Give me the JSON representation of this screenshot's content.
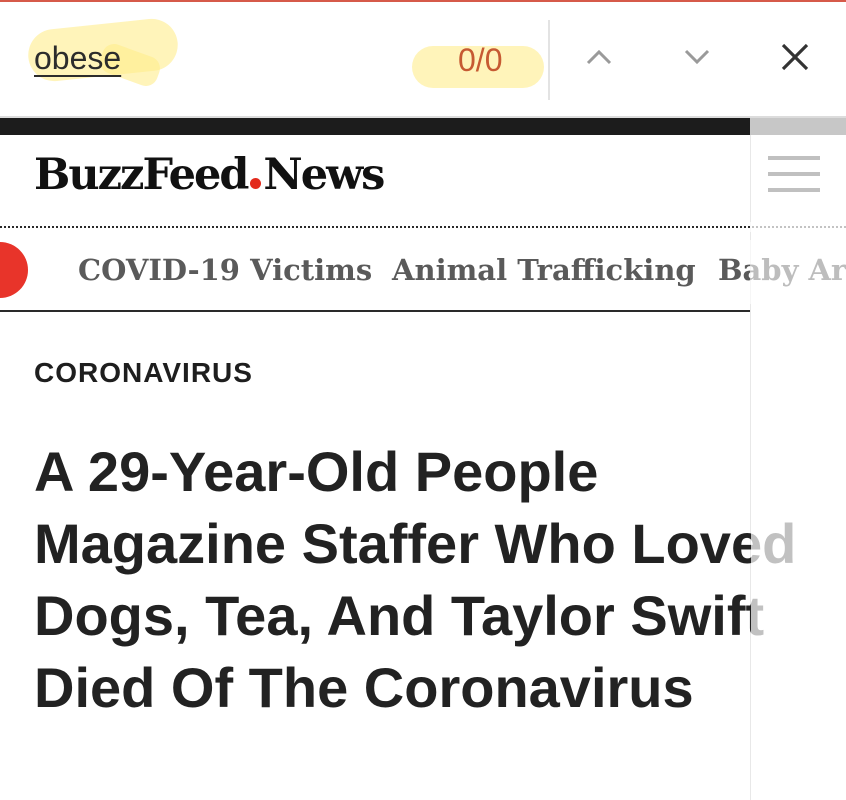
{
  "find_bar": {
    "query": "obese",
    "match_count": "0/0",
    "icons": {
      "previous": "chevron-up-icon",
      "next": "chevron-down-icon",
      "close": "close-icon"
    }
  },
  "site": {
    "logo_main": "BuzzFeed",
    "logo_sub": "News",
    "accent_color": "#e32a1c",
    "menu_icon": "hamburger-icon"
  },
  "topics": [
    "COVID-19 Victims",
    "Animal Trafficking",
    "Baby Arc"
  ],
  "article": {
    "section": "CORONAVIRUS",
    "headline": "A 29-Year-Old People Magazine Staffer Who Loved Dogs, Tea, And Taylor Swift Died Of The Coronavirus"
  }
}
